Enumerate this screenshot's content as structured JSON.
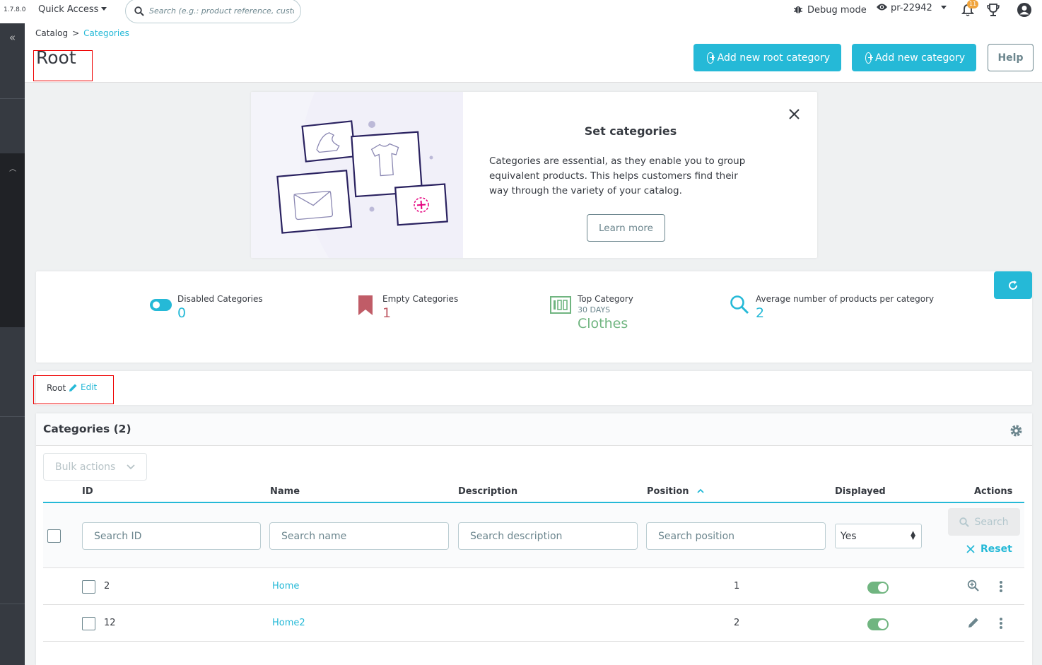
{
  "topbar": {
    "version": "1.7.8.0",
    "quick_access": "Quick Access",
    "search_placeholder": "Search (e.g.: product reference, custon",
    "debug_mode": "Debug mode",
    "shop": "pr-22942",
    "notifications_count": "11"
  },
  "header": {
    "breadcrumb_parent": "Catalog",
    "breadcrumb_sep": ">",
    "breadcrumb_current": "Categories",
    "title": "Root",
    "add_root_label": "Add new root category",
    "add_category_label": "Add new category",
    "help_label": "Help"
  },
  "onboarding": {
    "title": "Set categories",
    "description": "Categories are essential, as they enable you to group equivalent products. This helps customers find their way through the variety of your catalog.",
    "learn_more": "Learn more"
  },
  "kpi": {
    "disabled_label": "Disabled Categories",
    "disabled_value": "0",
    "empty_label": "Empty Categories",
    "empty_value": "1",
    "top_label": "Top Category",
    "top_sub": "30 DAYS",
    "top_value": "Clothes",
    "avg_label": "Average number of products per category",
    "avg_value": "2",
    "colors": {
      "disabled": "#25b9d7",
      "empty": "#c05c67",
      "top": "#70b580",
      "avg": "#25b9d7"
    }
  },
  "rootbar": {
    "label": "Root",
    "edit": "Edit"
  },
  "grid": {
    "title": "Categories (2)",
    "bulk_actions": "Bulk actions",
    "columns": {
      "id": "ID",
      "name": "Name",
      "description": "Description",
      "position": "Position",
      "displayed": "Displayed",
      "actions": "Actions"
    },
    "filters": {
      "id_placeholder": "Search ID",
      "name_placeholder": "Search name",
      "description_placeholder": "Search description",
      "position_placeholder": "Search position",
      "displayed_value": "Yes",
      "search_label": "Search",
      "reset_label": "Reset"
    },
    "rows": [
      {
        "id": "2",
        "name": "Home",
        "position": "1",
        "displayed": true
      },
      {
        "id": "12",
        "name": "Home2",
        "position": "2",
        "displayed": true
      }
    ]
  }
}
